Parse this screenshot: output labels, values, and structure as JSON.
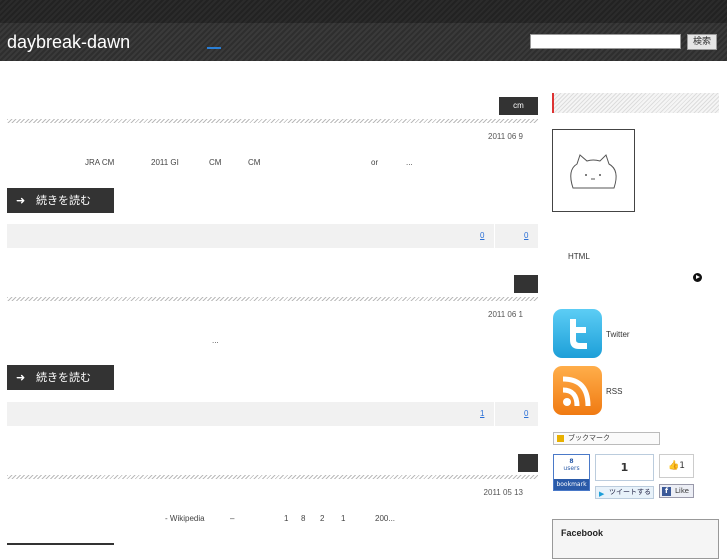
{
  "header": {
    "site_title": "daybreak-dawn",
    "search_placeholder": "",
    "search_button": "検索"
  },
  "posts": [
    {
      "tag": "cm",
      "date": "2011 06 9",
      "excerpt": [
        "JRA CM",
        "2011 GI",
        "CM",
        "CM",
        "or",
        "..."
      ],
      "readmore": "続きを読む",
      "meta_links": [
        "0",
        "0"
      ]
    },
    {
      "tag": "",
      "date": "2011 06 1",
      "excerpt": [
        "..."
      ],
      "readmore": "続きを読む",
      "meta_links": [
        "1",
        "0"
      ]
    },
    {
      "tag": "",
      "date": "2011 05 13",
      "excerpt": [
        "- Wikipedia",
        "–",
        "1",
        "8",
        "2",
        "1",
        "200..."
      ]
    }
  ],
  "sidebar": {
    "html_text": "HTML",
    "twitter_label": "Twitter",
    "rss_label": "RSS",
    "hatena_add": "ブックマーク",
    "hatena_count": "8",
    "hatena_users": "users",
    "hatena_bookmark": "bookmark",
    "tweet_count": "1",
    "tweet_button": "ツイートする",
    "like_count": "1",
    "like_button": "Like",
    "facebook_label": "Facebook"
  },
  "colors": {
    "header_bg": "#333333",
    "accent_red": "#dd3333",
    "link_blue": "#2a6fd6",
    "tag_bg": "#333333"
  },
  "icons": {
    "avatar": "cat-face-icon",
    "twitter": "twitter-bird-icon",
    "rss": "rss-feed-icon",
    "play": "play-circle-icon"
  }
}
